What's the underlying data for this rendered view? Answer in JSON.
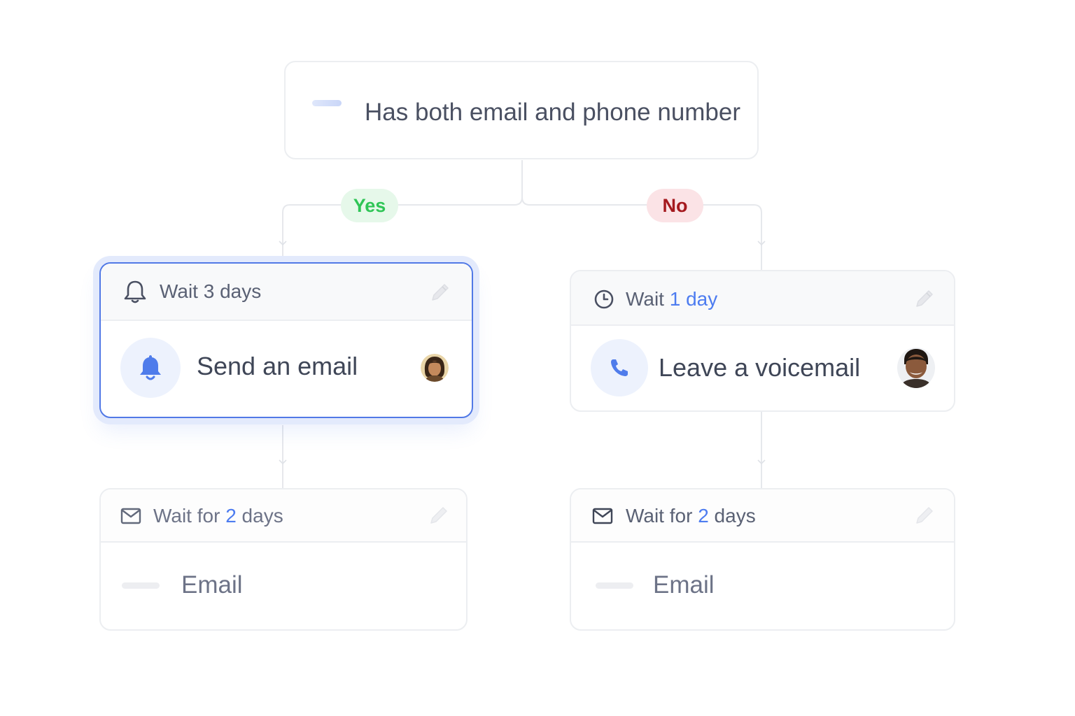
{
  "condition": {
    "label_prefix": "Has",
    "label_rest": " both email and phone number"
  },
  "branches": {
    "yes_label": "Yes",
    "no_label": "No"
  },
  "steps": [
    {
      "header_prefix": "Wait 3 days",
      "header_accent": "",
      "header_suffix": "",
      "header_icon": "bell-outline-icon",
      "action_label": "Send an email",
      "action_icon": "bell-icon",
      "selected": true
    },
    {
      "header_prefix": "Wait ",
      "header_accent": "1 day",
      "header_suffix": "",
      "header_icon": "clock-icon",
      "action_label": "Leave a voicemail",
      "action_icon": "phone-icon",
      "selected": false
    },
    {
      "header_prefix": "Wait for ",
      "header_accent": "2",
      "header_suffix": " days",
      "header_icon": "mail-icon",
      "action_label": "Email",
      "selected": false
    },
    {
      "header_prefix": "Wait for ",
      "header_accent": "2",
      "header_suffix": " days",
      "header_icon": "mail-icon",
      "action_label": "Email",
      "selected": false
    }
  ],
  "colors": {
    "accent": "#4d7cf0",
    "yes_bg": "#e6f8ea",
    "yes_text": "#2fc556",
    "no_bg": "#fbe3e6",
    "no_text": "#a51a1f"
  }
}
